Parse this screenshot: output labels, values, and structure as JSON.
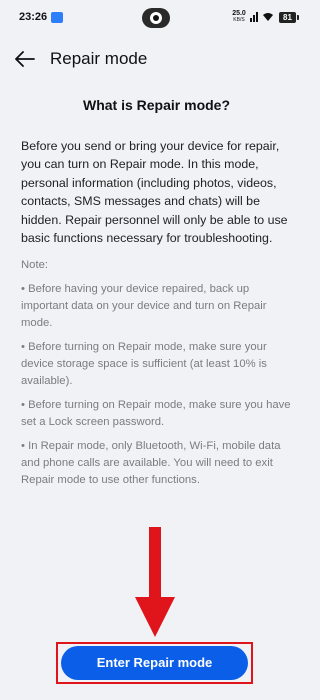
{
  "status_bar": {
    "time": "23:26",
    "net_speed_value": "25.0",
    "net_speed_unit": "KB/S",
    "battery": "81",
    "icons": [
      "app-notification-icon",
      "camera-icon",
      "signal-icon",
      "wifi-icon",
      "battery-icon"
    ]
  },
  "header": {
    "title": "Repair mode",
    "back_icon": "arrow-left-icon"
  },
  "content": {
    "section_title": "What is Repair mode?",
    "description": "Before you send or bring your device for repair, you can turn on Repair mode. In this mode, personal information (including photos, videos, contacts, SMS messages and chats) will be hidden. Repair personnel will only be able to use basic functions necessary for troubleshooting.",
    "note_label": "Note:",
    "notes": [
      "• Before having your device repaired, back up important data on your device and turn on Repair mode.",
      "• Before turning on Repair mode, make sure your device storage space is sufficient (at least 10% is available).",
      "• Before turning on Repair mode, make sure you have set a Lock screen password.",
      "• In Repair mode, only Bluetooth, Wi-Fi, mobile data and phone calls are available. You will need to exit Repair mode to use other functions."
    ]
  },
  "action": {
    "enter_label": "Enter Repair mode"
  },
  "colors": {
    "background": "#f1f2f6",
    "button": "#0a5ee8",
    "annotation": "#e0141b"
  }
}
